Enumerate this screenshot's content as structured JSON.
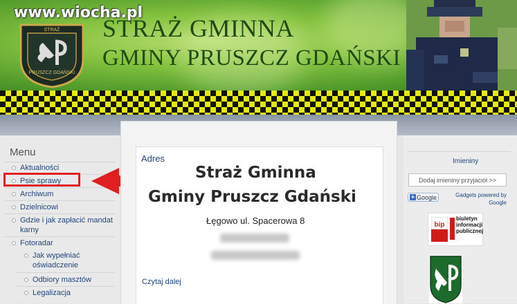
{
  "header": {
    "watermark": "www.wiocha.pl",
    "title_line1": "STRAŻ GMINNA",
    "title_line2": "GMINY PRUSZCZ GDAŃSKI",
    "badge_text_top": "STRAŻ",
    "badge_text_bottom": "PRUSZCZ GDAŃSKI",
    "colors": {
      "title": "#1e4b14",
      "checker_yellow": "#e5ec0b",
      "checker_black": "#111111"
    }
  },
  "sidebar": {
    "title": "Menu",
    "items": [
      {
        "label": "Aktualności",
        "level": 1
      },
      {
        "label": "Psie sprawy",
        "level": 1,
        "highlighted": true
      },
      {
        "label": "Archiwum",
        "level": 1
      },
      {
        "label": "Dzielnicowi",
        "level": 1
      },
      {
        "label": "Gdzie i jak zapłacić mandat karny",
        "level": 1
      },
      {
        "label": "Fotoradar",
        "level": 1
      },
      {
        "label": "Jak wypełniać oświadczenie",
        "level": 2
      },
      {
        "label": "Odbiory masztów",
        "level": 2
      },
      {
        "label": "Legalizacja",
        "level": 2
      }
    ],
    "annotation_colors": {
      "highlight_box": "#e02020",
      "arrow": "#e02020"
    }
  },
  "main": {
    "card_title": "Adres",
    "name_line1": "Straż Gminna",
    "name_line2": "Gminy Pruszcz Gdański",
    "address": "Łęgowo ul. Spacerowa 8",
    "read_more": "Czytaj dalej"
  },
  "right": {
    "imieniny_title": "Imieniny",
    "imieniny_button": "Dodaj imieniny przyjaciół >>",
    "google_button": "Google",
    "gadgets_line1": "Gadgets powered by",
    "gadgets_line2": "Google",
    "bip_logo": "bip",
    "bip_text": [
      "biuletyn",
      "informacji",
      "publicznej"
    ]
  },
  "icons": [
    "badge-icon",
    "arrow-icon",
    "google-plus-icon",
    "bip-flag-icon",
    "crest-icon"
  ]
}
